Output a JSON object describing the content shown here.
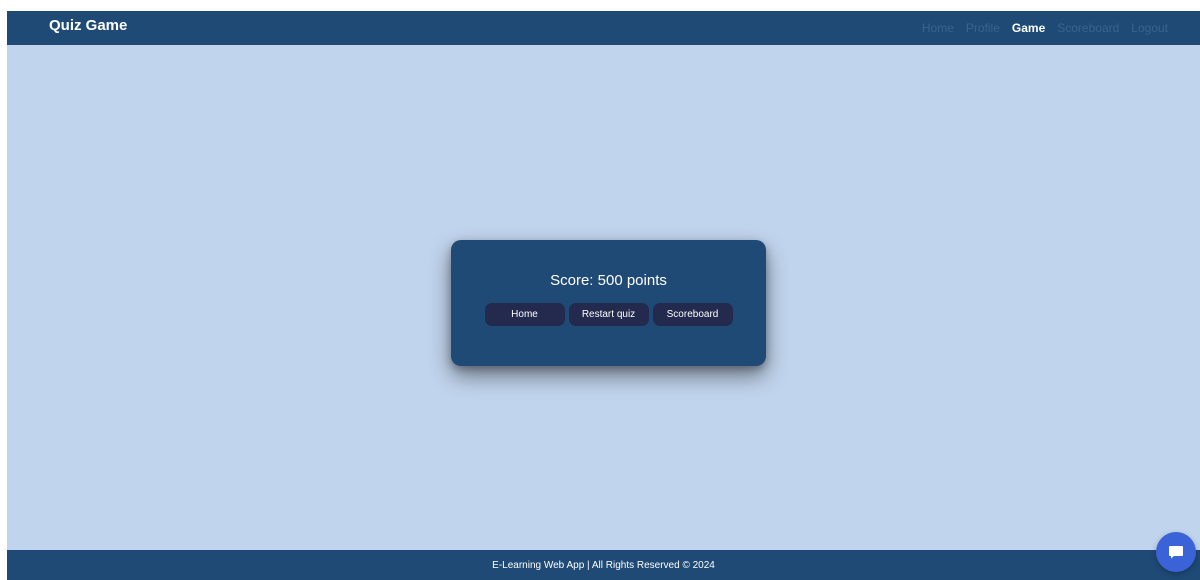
{
  "navbar": {
    "brand": "Quiz Game",
    "links": [
      {
        "label": "Home"
      },
      {
        "label": "Profile"
      },
      {
        "label": "Game"
      },
      {
        "label": "Scoreboard"
      },
      {
        "label": "Logout"
      }
    ],
    "active": "Game"
  },
  "result": {
    "score_text": "Score: 500 points",
    "buttons": {
      "home": "Home",
      "restart": "Restart quiz",
      "scoreboard": "Scoreboard"
    }
  },
  "footer": {
    "text": "E-Learning Web App | All Rights Reserved © 2024"
  },
  "chat": {
    "icon": "chat-bubble-icon"
  },
  "colors": {
    "navbar": "#1f4a75",
    "background": "#c1d4ed",
    "button": "#232a4d",
    "chat": "#3b63d8",
    "inactive_link": "#36648f"
  }
}
